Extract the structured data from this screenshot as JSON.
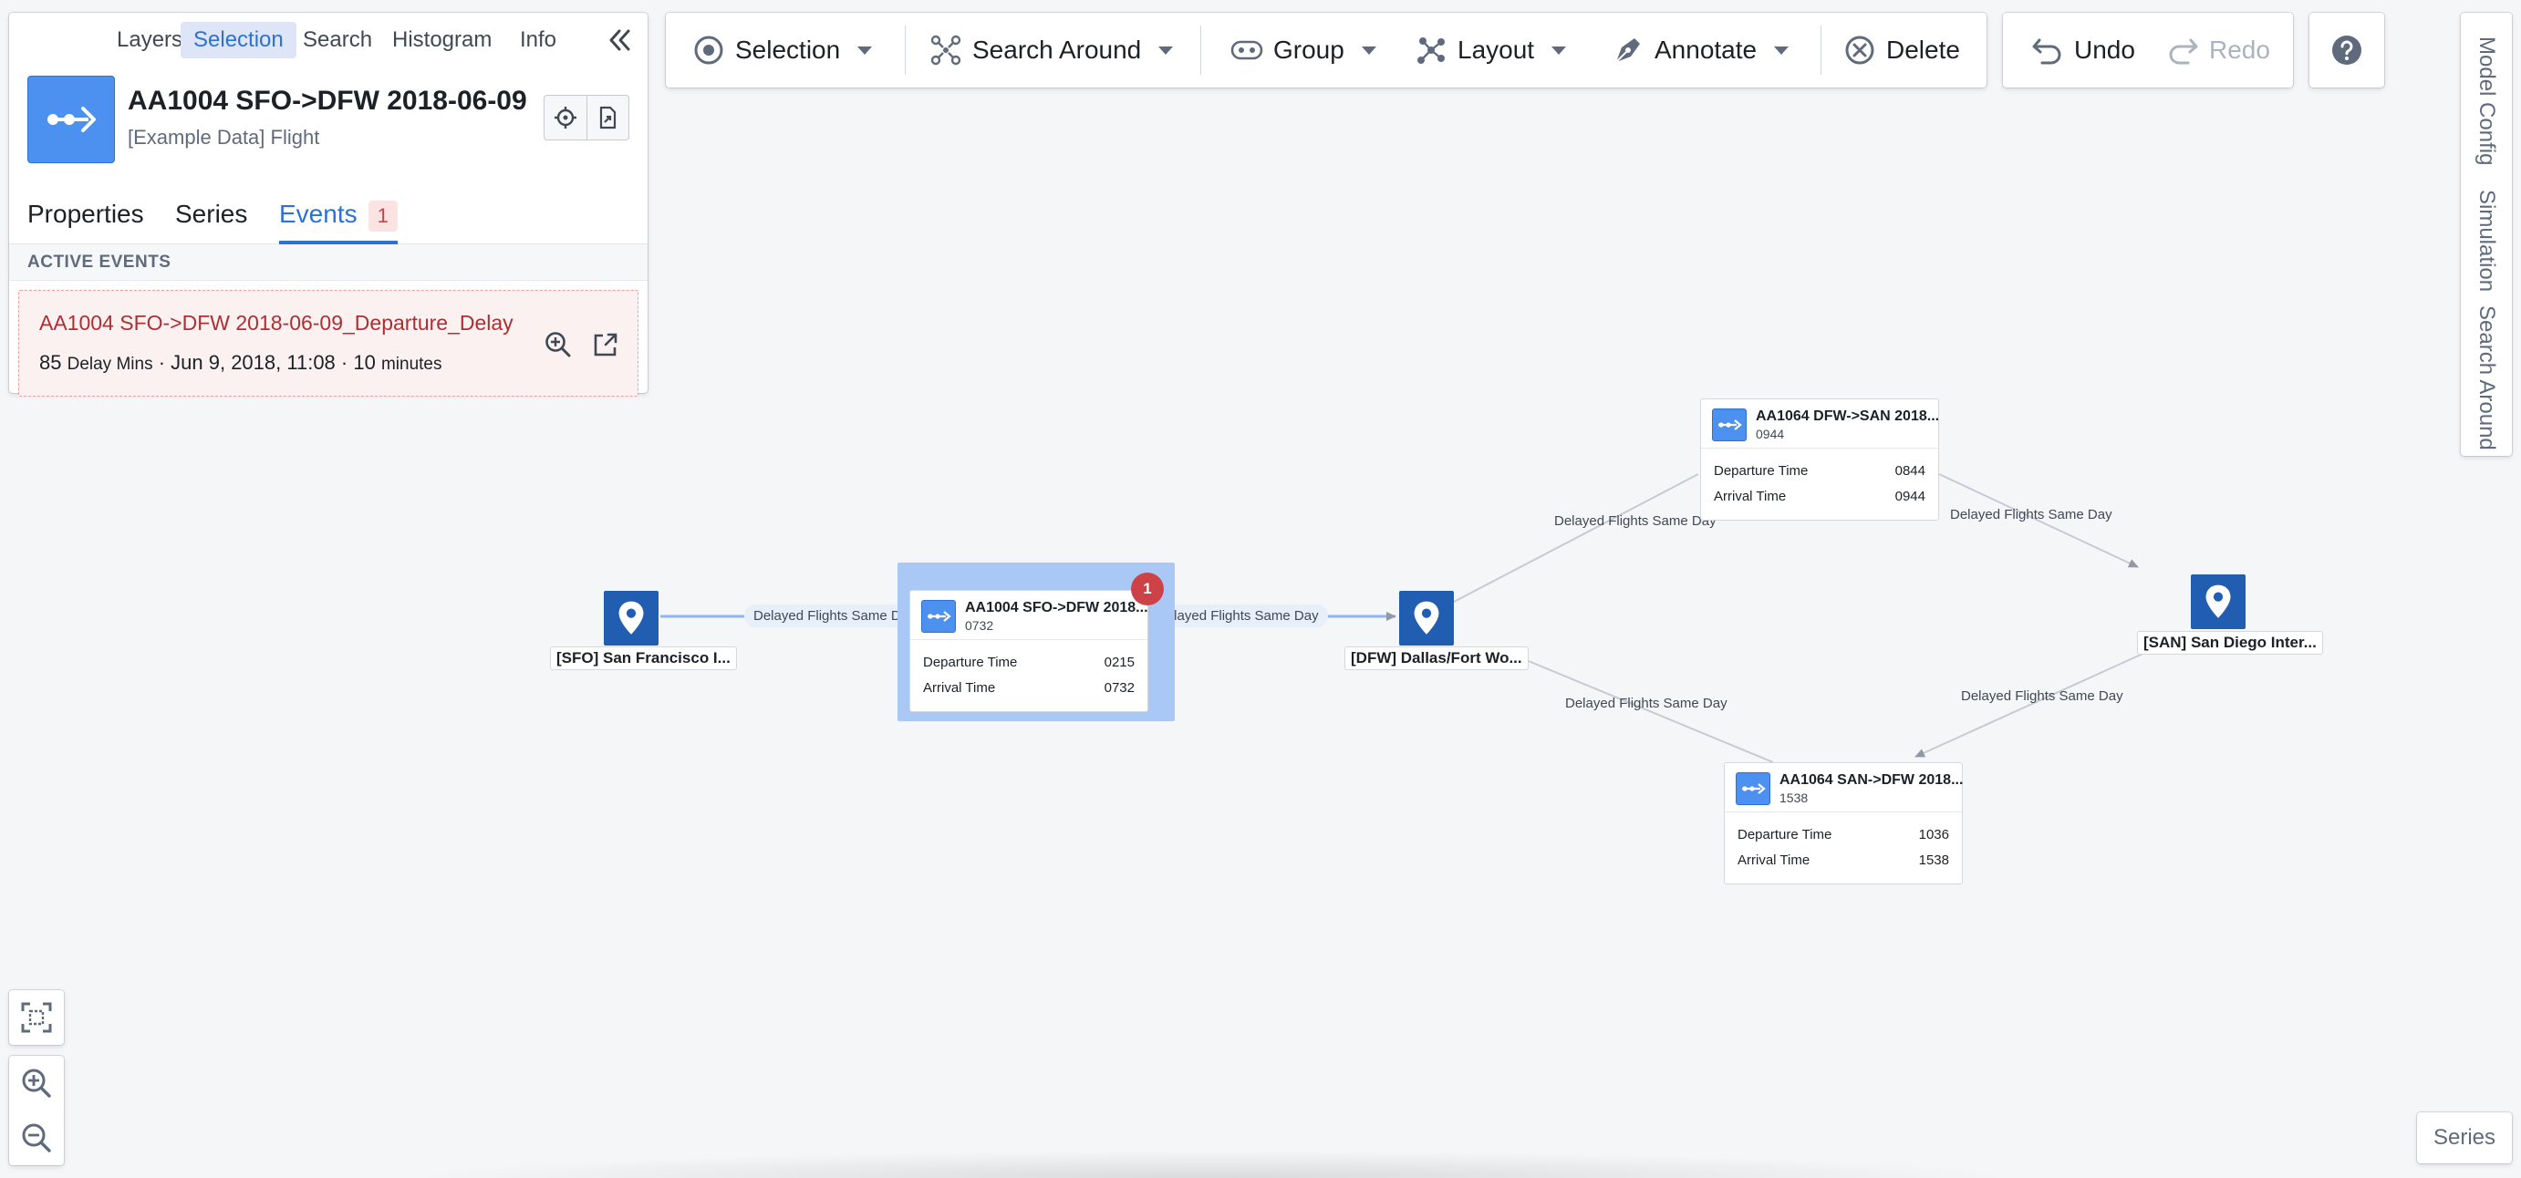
{
  "panel": {
    "tabs": [
      "Layers",
      "Selection",
      "Search",
      "Histogram",
      "Info"
    ],
    "active_tab": "Selection",
    "object": {
      "title": "AA1004 SFO->DFW 2018-06-09",
      "subtitle": "[Example Data] Flight",
      "icon": "flight-route-icon"
    },
    "detail_tabs": {
      "properties": "Properties",
      "series": "Series",
      "events": "Events",
      "events_count": "1"
    },
    "active_events_header": "ACTIVE EVENTS",
    "event": {
      "title": "AA1004 SFO->DFW 2018-06-09_Departure_Delay",
      "value": "85",
      "unit": "Delay Mins",
      "date": "· Jun 9, 2018, 11:08 ·",
      "duration_value": "10",
      "duration_unit": "minutes"
    }
  },
  "toolbar": {
    "selection": "Selection",
    "search_around": "Search Around",
    "group": "Group",
    "layout": "Layout",
    "annotate": "Annotate",
    "delete": "Delete",
    "undo": "Undo",
    "redo": "Redo"
  },
  "right_tabs": [
    "Model Config",
    "Simulation",
    "Search Around"
  ],
  "graph": {
    "locations": {
      "sfo": "[SFO] San Francisco I...",
      "dfw": "[DFW] Dallas/Fort Wo...",
      "san": "[SAN] San Diego Inter..."
    },
    "flights": {
      "aa1004": {
        "title": "AA1004 SFO->DFW 2018...",
        "sub": "0732",
        "dep_label": "Departure Time",
        "dep": "0215",
        "arr_label": "Arrival Time",
        "arr": "0732",
        "badge": "1"
      },
      "aa1064_dfw_san": {
        "title": "AA1064 DFW->SAN 2018...",
        "sub": "0944",
        "dep_label": "Departure Time",
        "dep": "0844",
        "arr_label": "Arrival Time",
        "arr": "0944"
      },
      "aa1064_san_dfw": {
        "title": "AA1064 SAN->DFW 2018...",
        "sub": "1538",
        "dep_label": "Departure Time",
        "dep": "1036",
        "arr_label": "Arrival Time",
        "arr": "1538"
      }
    },
    "edge_label": "Delayed Flights Same Day"
  },
  "series_button": "Series",
  "colors": {
    "accent": "#2d72d2",
    "location_node": "#215db0",
    "flight_icon": "#4c90f0",
    "event_red": "#cd4246",
    "selection_highlight": "#a9c8f5"
  }
}
